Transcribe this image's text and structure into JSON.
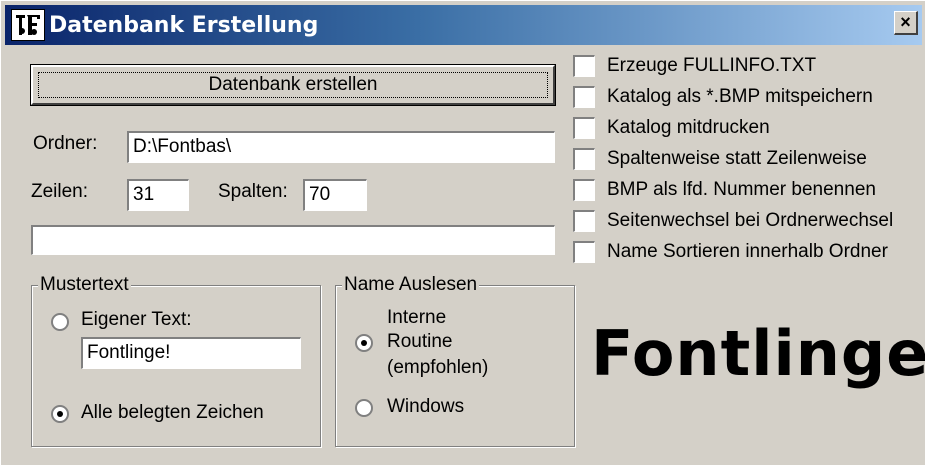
{
  "window": {
    "title": "Datenbank Erstellung",
    "close_label": "×"
  },
  "main_button": {
    "label": "Datenbank erstellen"
  },
  "folder": {
    "label": "Ordner:",
    "value": "D:\\Fontbas\\"
  },
  "rows": {
    "label": "Zeilen:",
    "value": "31"
  },
  "cols": {
    "label": "Spalten:",
    "value": "70"
  },
  "progress": {
    "value": 0
  },
  "mustertext": {
    "title": "Mustertext",
    "own_text_label": "Eigener Text:",
    "own_text_value": "Fontlinge!",
    "all_chars_label": "Alle belegten Zeichen",
    "selected": "all_chars"
  },
  "name_auslesen": {
    "title": "Name Auslesen",
    "internal_label_1": "Interne",
    "internal_label_2": "Routine",
    "internal_label_3": "(empfohlen)",
    "windows_label": "Windows",
    "selected": "internal"
  },
  "options": [
    {
      "label": "Erzeuge FULLINFO.TXT",
      "checked": false
    },
    {
      "label": "Katalog als *.BMP mitspeichern",
      "checked": false
    },
    {
      "label": "Katalog mitdrucken",
      "checked": false
    },
    {
      "label": "Spaltenweise statt Zeilenweise",
      "checked": false
    },
    {
      "label": "BMP als lfd. Nummer benennen",
      "checked": false
    },
    {
      "label": "Seitenwechsel bei Ordnerwechsel",
      "checked": false
    },
    {
      "label": "Name Sortieren innerhalb Ordner",
      "checked": false
    }
  ],
  "preview_text": "Fontlinge!"
}
